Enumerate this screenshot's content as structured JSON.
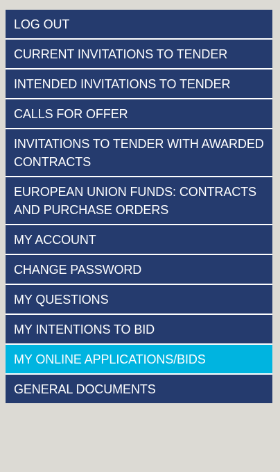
{
  "menu": {
    "items": [
      {
        "label": "LOG OUT"
      },
      {
        "label": "CURRENT INVITATIONS TO TENDER"
      },
      {
        "label": "INTENDED INVITATIONS TO TENDER"
      },
      {
        "label": "CALLS FOR OFFER"
      },
      {
        "label": "INVITATIONS TO TENDER WITH AWARDED CONTRACTS"
      },
      {
        "label": "EUROPEAN UNION FUNDS: CONTRACTS AND PURCHASE ORDERS"
      },
      {
        "label": "MY ACCOUNT"
      },
      {
        "label": "CHANGE PASSWORD"
      },
      {
        "label": "MY QUESTIONS"
      },
      {
        "label": "MY INTENTIONS TO BID"
      },
      {
        "label": "MY ONLINE APPLICATIONS/BIDS"
      },
      {
        "label": "GENERAL DOCUMENTS"
      }
    ],
    "active_index": 10,
    "colors": {
      "item_bg": "#253b6e",
      "active_bg": "#00b4e0",
      "text": "#ffffff"
    }
  }
}
